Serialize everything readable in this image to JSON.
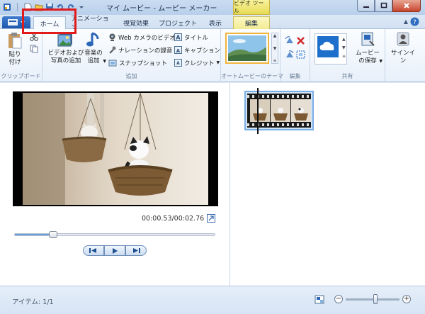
{
  "window": {
    "title": "マイ ムービー - ムービー メーカー",
    "context_tab_title": "ビデオ ツール"
  },
  "tabs": {
    "home": "ホーム",
    "animation": "アニメーション",
    "visual_effects": "視覚効果",
    "project": "プロジェクト",
    "view": "表示",
    "edit": "編集"
  },
  "ribbon": {
    "clipboard": {
      "paste_label": "貼り\n付け",
      "group_label": "クリップボード"
    },
    "add": {
      "add_videos_photos": "ビデオおよび\n写真の追加",
      "add_music": "音楽の\n追加",
      "webcam_video": "Web カメラのビデオ",
      "record_narration": "ナレーションの録音",
      "snapshot": "スナップショット",
      "title": "タイトル",
      "caption": "キャプション",
      "credits": "クレジット",
      "group_label": "追加"
    },
    "automovie": {
      "group_label": "オートムービーのテーマ"
    },
    "editing": {
      "group_label": "編集"
    },
    "share": {
      "save_movie": "ムービー\nの保存",
      "group_label": "共有"
    },
    "signin": {
      "label": "サインイン"
    }
  },
  "player": {
    "timecode": "00:00.53/00:02.76",
    "position_fraction": 0.19
  },
  "status": {
    "item_count": "アイテム: 1/1",
    "zoom_fraction": 0.55
  },
  "colors": {
    "highlight": "#e11b1b",
    "file_tab": "#1e57ad",
    "context_tab": "#e7da55",
    "theme_border": "#f0b53c"
  }
}
